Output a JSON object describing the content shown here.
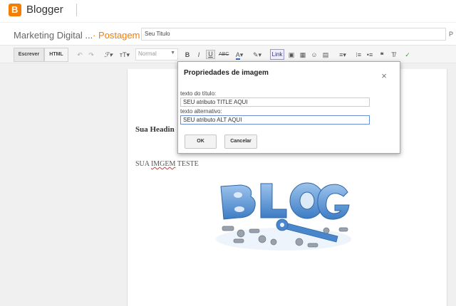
{
  "app": {
    "brand": "Blogger",
    "accent": "#f57d00"
  },
  "title_row": {
    "blog_name": "Marketing Digital ...",
    "post_label": "· Postagem",
    "title_value": "Seu Titulo"
  },
  "toolbar": {
    "compose_label": "Escrever",
    "html_label": "HTML",
    "format_value": "Normal",
    "link_label": "Link"
  },
  "editor": {
    "heading": "Sua Headin",
    "body_prefix": "SUA ",
    "body_misspelled": "IMGEM",
    "body_suffix": " TESTE"
  },
  "dialog": {
    "title": "Propriedades de imagem",
    "title_label": "texto do título:",
    "title_value": "SEU atributo TITLE AQUI",
    "alt_label": "texto alternativo:",
    "alt_value": "SEU atributo ALT AQUI",
    "ok_label": "OK",
    "cancel_label": "Cancelar"
  }
}
